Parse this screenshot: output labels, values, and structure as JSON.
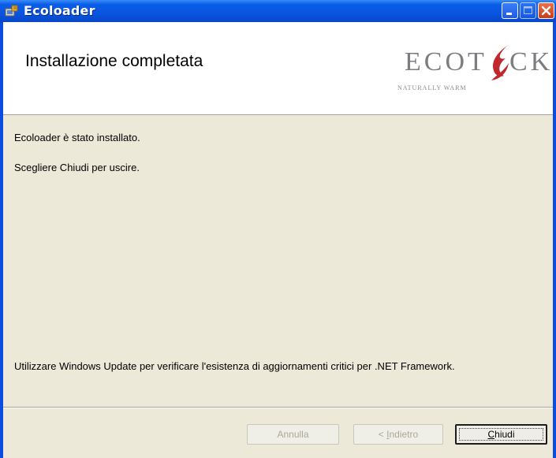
{
  "window": {
    "title": "Ecoloader"
  },
  "header": {
    "title": "Installazione completata",
    "logo_text_left": "ECOT",
    "logo_text_right": "CK",
    "logo_tagline": "NATURALLY WARM"
  },
  "body": {
    "line1": "Ecoloader è stato installato.",
    "line2": "Scegliere Chiudi per uscire.",
    "line3": "Utilizzare Windows Update per verificare l'esistenza di aggiornamenti critici per .NET Framework."
  },
  "buttons": {
    "cancel_label": "Annulla",
    "back_prefix": "< ",
    "back_mnemonic": "I",
    "back_rest": "ndietro",
    "close_mnemonic": "C",
    "close_rest": "hiudi"
  },
  "colors": {
    "titlebar": "#0a55e0",
    "dialog_bg": "#ece9d8",
    "logo_red": "#c0282d"
  },
  "icons": {
    "app": "installer-icon",
    "minimize": "minimize-icon",
    "maximize": "maximize-icon",
    "close": "close-icon"
  }
}
